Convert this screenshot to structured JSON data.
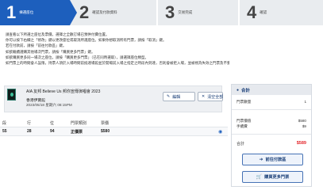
{
  "steps": [
    {
      "num": "1",
      "label": "揀選座位",
      "active": true
    },
    {
      "num": "2",
      "label": "確認及付款資料",
      "active": false
    },
    {
      "num": "3",
      "label": "交易完成",
      "active": false
    },
    {
      "num": "4",
      "label": "確認",
      "active": false
    }
  ],
  "instructions": [
    "請查看以下所選之座位及票價，選擇之全數訂場已預供付費位置。",
    "你可以按下右欄之「修改」鍵以更改座位或取消所選座位。如果你想取消所有門票，請按「取消」鍵。",
    "若在付款前，請按「前往付款區」鍵。",
    "如欲繼續選購其他場次門票，請按「購買更多門票」鍵。",
    "如欲購買更多同一場次之座位，請按「購買更多門票」（已在同時選取），請選擇座位類型。",
    "如門票上的時間會人設限，持票人須於入場時間前抵達場館並於開場前入場之指定之時段內到達，否則會被拒入場，並被視為失效之門票及不獲退款。"
  ],
  "event": {
    "title": "AIA 友邦 Believe Us 邦你宣傳演唱會 2023",
    "venue": "香港伊寶館",
    "datetime": "2023/05/18 星期六 08:15PM",
    "edit_label": "編輯",
    "clear_label": "清空全部"
  },
  "table": {
    "headers": [
      "段",
      "行",
      "位",
      "門票類別",
      "票價"
    ],
    "rows": [
      {
        "section": "55",
        "row": "28",
        "seat": "94",
        "category": "正價票",
        "price": "$580"
      }
    ]
  },
  "summary": {
    "title": "合計",
    "ticket_count_label": "門票數量",
    "ticket_count": "1",
    "ticket_price_label": "門票價值",
    "ticket_price": "$580",
    "fee_label": "手續費",
    "fee": "$9",
    "total_label": "合計",
    "total": "$589",
    "checkout_label": "前往付款區",
    "buy_more_label": "購買更多門票"
  },
  "colors": {
    "accent": "#1d5fbd",
    "total": "#e3262b"
  }
}
